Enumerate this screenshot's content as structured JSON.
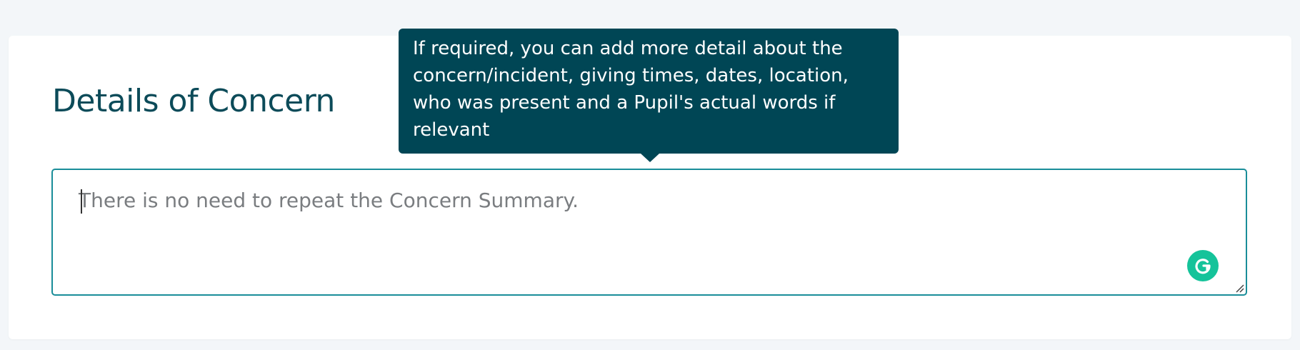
{
  "section": {
    "title": "Details of Concern"
  },
  "tooltip": {
    "text": "If required, you can add more detail about the concern/incident, giving times, dates, location, who was present and a Pupil's actual words if relevant"
  },
  "details_field": {
    "placeholder": "There is no need to repeat the Concern Summary.",
    "value": ""
  },
  "icons": {
    "grammarly": "grammarly-icon",
    "resize": "resize-handle-icon"
  },
  "colors": {
    "title": "#0c4b59",
    "tooltip_bg": "#004655",
    "field_border": "#1a8d99",
    "grammarly": "#15c39a",
    "page_bg": "#f3f6f9"
  }
}
